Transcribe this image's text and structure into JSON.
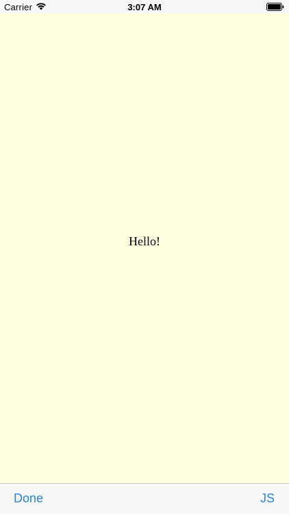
{
  "status_bar": {
    "carrier": "Carrier",
    "time": "3:07 AM",
    "wifi_icon": "wifi-icon",
    "battery_icon": "battery-icon"
  },
  "web_view": {
    "background_color": "#ffffe0",
    "text": "Hello!"
  },
  "toolbar": {
    "done_label": "Done",
    "js_label": "JS",
    "tint_color": "#2a86d6"
  }
}
